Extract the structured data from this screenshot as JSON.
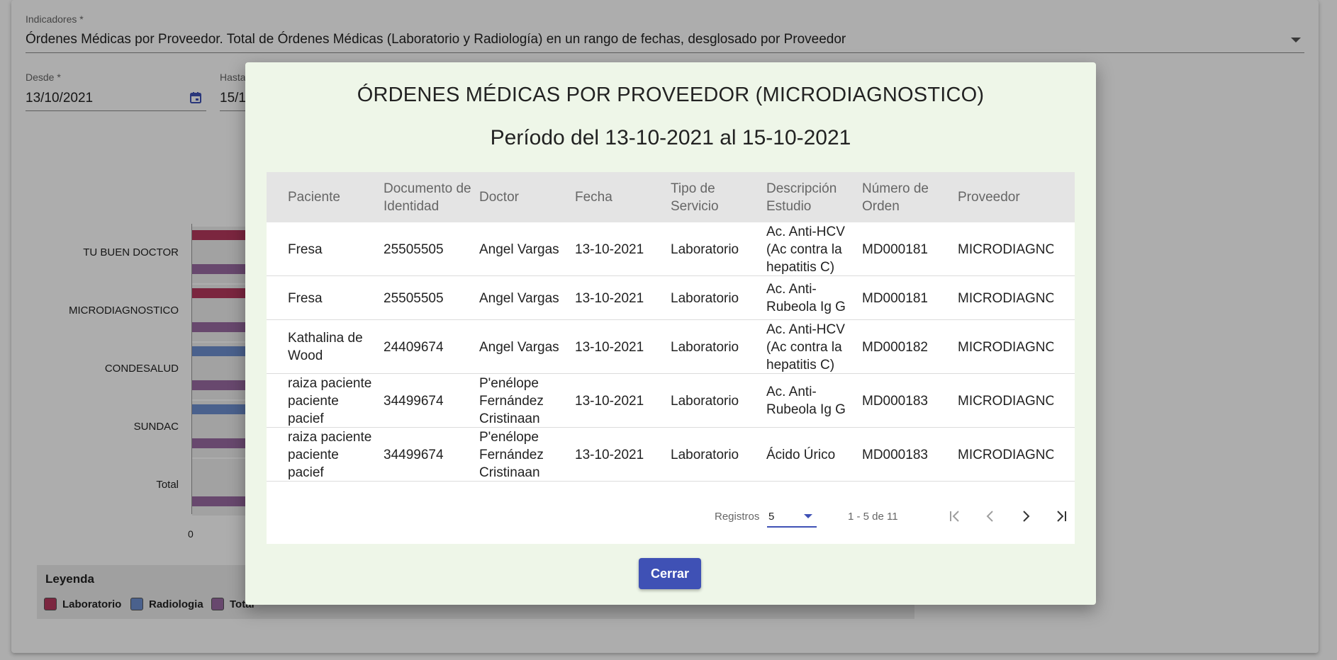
{
  "form": {
    "indicadores_label": "Indicadores *",
    "indicadores_value": "Órdenes Médicas por Proveedor. Total de Órdenes Médicas (Laboratorio y Radiología) en un rango de fechas, desglosado por Proveedor",
    "desde_label": "Desde *",
    "desde_value": "13/10/2021",
    "hasta_label": "Hasta",
    "hasta_value": "15/1"
  },
  "chart_data": {
    "type": "bar",
    "categories": [
      "TU BUEN DOCTOR",
      "MICRODIAGNOSTICO",
      "CONDESALUD",
      "SUNDAC",
      "Total"
    ],
    "x_tick_first": "0",
    "series_colors": {
      "Laboratorio": "#b5385e",
      "Radiologia": "#6d8fd0",
      "Total": "#9a6aa2"
    }
  },
  "legend": {
    "title": "Leyenda",
    "items": [
      {
        "label": "Laboratorio",
        "color": "#b5385e"
      },
      {
        "label": "Radiologia",
        "color": "#6d8fd0"
      },
      {
        "label": "Total",
        "color": "#9a6aa2"
      }
    ]
  },
  "modal": {
    "title": "ÓRDENES MÉDICAS POR PROVEEDOR (MICRODIAGNOSTICO)",
    "subtitle": "Período del 13-10-2021 al 15-10-2021",
    "columns": [
      "Paciente",
      "Documento de Identidad",
      "Doctor",
      "Fecha",
      "Tipo de Servicio",
      "Descripción Estudio",
      "Número de Orden",
      "Proveedor"
    ],
    "rows": [
      [
        "Fresa",
        "25505505",
        "Angel Vargas",
        "13-10-2021",
        "Laboratorio",
        "Ac. Anti-HCV (Ac contra la hepatitis C)",
        "MD000181",
        "MICRODIAGNOSTICO"
      ],
      [
        "Fresa",
        "25505505",
        "Angel Vargas",
        "13-10-2021",
        "Laboratorio",
        "Ac. Anti-Rubeola Ig G",
        "MD000181",
        "MICRODIAGNOSTICO"
      ],
      [
        "Kathalina de Wood",
        "24409674",
        "Angel Vargas",
        "13-10-2021",
        "Laboratorio",
        "Ac. Anti-HCV (Ac contra la hepatitis C)",
        "MD000182",
        "MICRODIAGNOSTICO"
      ],
      [
        "raiza paciente paciente pacief",
        "34499674",
        "P'enélope Fernández Cristinaan",
        "13-10-2021",
        "Laboratorio",
        "Ac. Anti-Rubeola Ig G",
        "MD000183",
        "MICRODIAGNOSTICO"
      ],
      [
        "raiza paciente paciente pacief",
        "34499674",
        "P'enélope Fernández Cristinaan",
        "13-10-2021",
        "Laboratorio",
        "Ácido Úrico",
        "MD000183",
        "MICRODIAGNOSTICO"
      ]
    ],
    "row_lines": [
      [
        [
          "Fresa"
        ],
        [
          "25505505"
        ],
        [
          "Angel Vargas"
        ],
        [
          "13-10-2021"
        ],
        [
          "Laboratorio"
        ],
        [
          "Ac. Anti-HCV",
          "(Ac contra la",
          "hepatitis C)"
        ],
        [
          "MD000181"
        ],
        [
          "MICRODIAGNOSTI"
        ]
      ],
      [
        [
          "Fresa"
        ],
        [
          "25505505"
        ],
        [
          "Angel Vargas"
        ],
        [
          "13-10-2021"
        ],
        [
          "Laboratorio"
        ],
        [
          "Ac. Anti-",
          "Rubeola Ig G"
        ],
        [
          "MD000181"
        ],
        [
          "MICRODIAGNOSTI"
        ]
      ],
      [
        [
          "Kathalina de",
          "Wood"
        ],
        [
          "24409674"
        ],
        [
          "Angel Vargas"
        ],
        [
          "13-10-2021"
        ],
        [
          "Laboratorio"
        ],
        [
          "Ac. Anti-HCV",
          "(Ac contra la",
          "hepatitis C)"
        ],
        [
          "MD000182"
        ],
        [
          "MICRODIAGNOSTI"
        ]
      ],
      [
        [
          "raiza paciente",
          "paciente",
          "pacief"
        ],
        [
          "34499674"
        ],
        [
          "P'enélope",
          "Fernández",
          "Cristinaan"
        ],
        [
          "13-10-2021"
        ],
        [
          "Laboratorio"
        ],
        [
          "Ac. Anti-",
          "Rubeola Ig G"
        ],
        [
          "MD000183"
        ],
        [
          "MICRODIAGNOSTI"
        ]
      ],
      [
        [
          "raiza paciente",
          "paciente",
          "pacief"
        ],
        [
          "34499674"
        ],
        [
          "P'enélope",
          "Fernández",
          "Cristinaan"
        ],
        [
          "13-10-2021"
        ],
        [
          "Laboratorio"
        ],
        [
          "Ácido Úrico"
        ],
        [
          "MD000183"
        ],
        [
          "MICRODIAGNOSTI"
        ]
      ]
    ],
    "header_lines": [
      [
        "Paciente"
      ],
      [
        "Documento de",
        "Identidad"
      ],
      [
        "Doctor"
      ],
      [
        "Fecha"
      ],
      [
        "Tipo de",
        "Servicio"
      ],
      [
        "Descripción",
        "Estudio"
      ],
      [
        "Número de",
        "Orden"
      ],
      [
        "Proveedor"
      ]
    ],
    "paginator": {
      "registros_label": "Registros",
      "page_size": "5",
      "range_label": "1 - 5 de 11"
    },
    "close_label": "Cerrar"
  }
}
